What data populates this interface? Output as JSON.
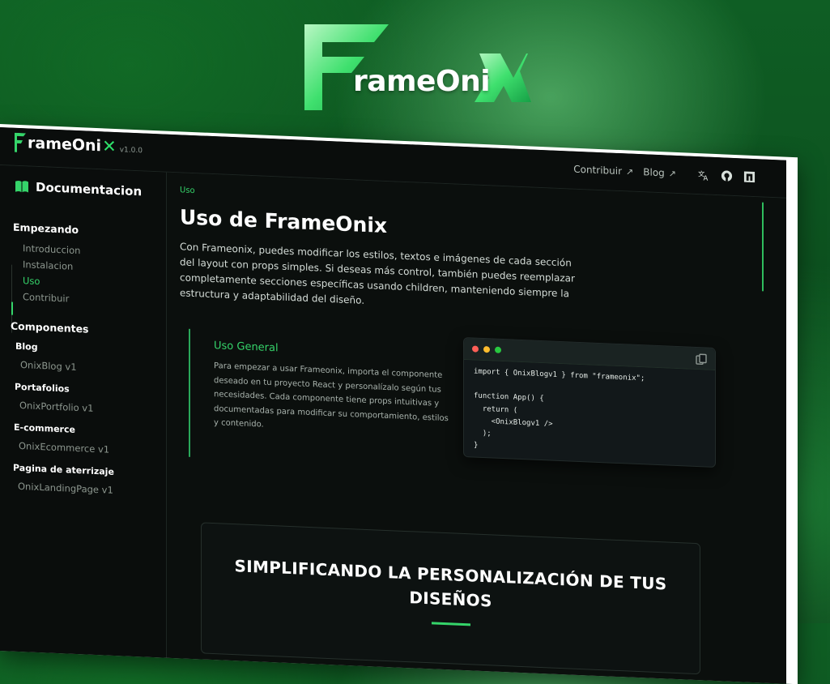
{
  "hero": {
    "logo_text": "rameOni"
  },
  "header": {
    "brand_text": "rameOni",
    "version": "v1.0.0",
    "links": [
      {
        "label": "Contribuir",
        "arrow": "↗"
      },
      {
        "label": "Blog",
        "arrow": "↗"
      }
    ]
  },
  "sidebar": {
    "title": "Documentacion",
    "sections": [
      {
        "title": "Empezando"
      },
      {
        "title": "Componentes"
      }
    ],
    "getting_started": [
      "Introduccion",
      "Instalacion",
      "Uso",
      "Contribuir"
    ],
    "groups": [
      {
        "title": "Blog",
        "item": "OnixBlog v1"
      },
      {
        "title": "Portafolios",
        "item": "OnixPortfolio v1"
      },
      {
        "title": "E-commerce",
        "item": "OnixEcommerce v1"
      },
      {
        "title": "Pagina de aterrizaje",
        "item": "OnixLandingPage v1"
      }
    ]
  },
  "main": {
    "breadcrumb": "Uso",
    "title": "Uso de FrameOnix",
    "intro": "Con Frameonix, puedes modificar los estilos, textos e imágenes de cada sección del layout con props simples. Si deseas más control, también puedes reemplazar completamente secciones específicas usando children, manteniendo siempre la estructura y adaptabilidad del diseño.",
    "usage": {
      "title": "Uso General",
      "text": "Para empezar a usar Frameonix, importa el componente deseado en tu proyecto React y personalízalo según tus necesidades. Cada componente tiene props intuitivas y documentadas para modificar su comportamiento, estilos y contenido."
    },
    "code": "import { OnixBlogv1 } from \"frameonix\";\n\nfunction App() {\n  return (\n    <OnixBlogv1 />\n  );\n}",
    "banner_title": "SIMPLIFICANDO LA PERSONALIZACIÓN DE TUS DISEÑOS"
  },
  "colors": {
    "accent": "#35d46a",
    "background": "#0b0f0d",
    "page_bg": "#0f5e24"
  }
}
